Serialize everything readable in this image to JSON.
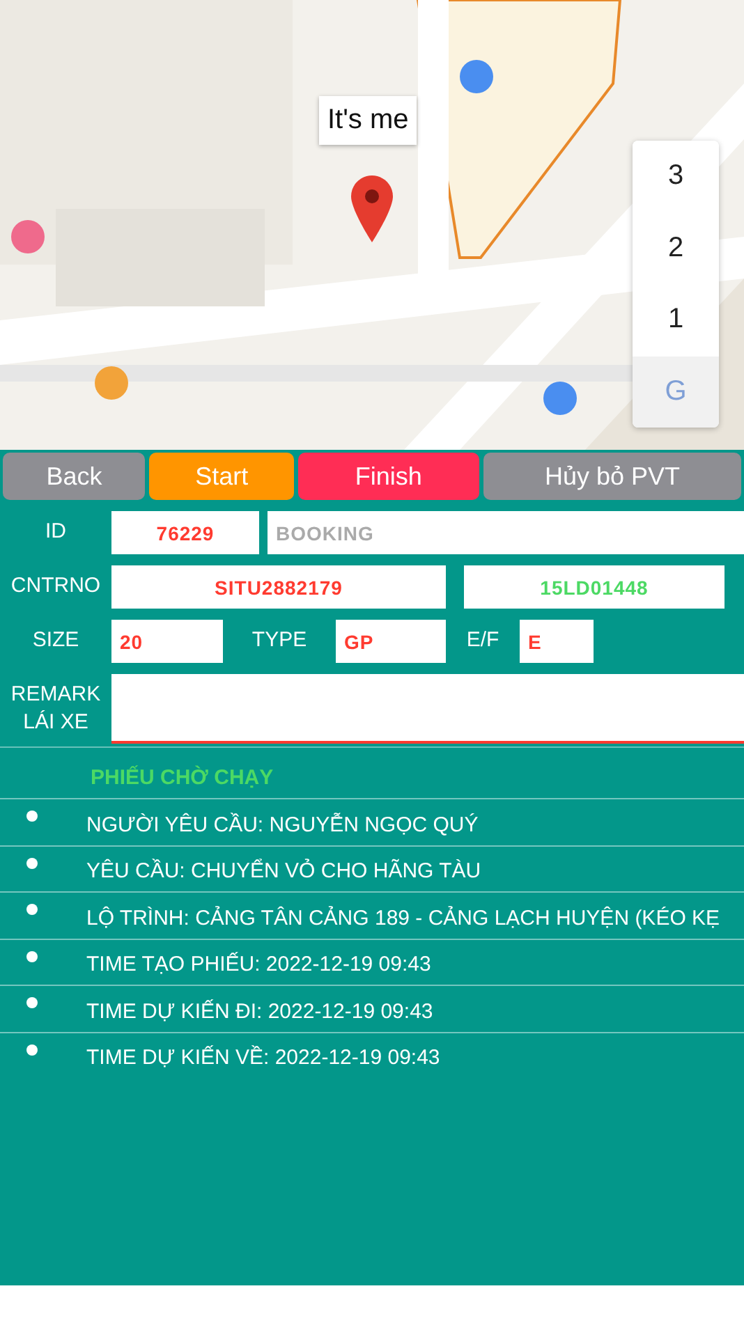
{
  "map": {
    "callout": "It's me",
    "floors": [
      {
        "label": "3",
        "selected": false
      },
      {
        "label": "2",
        "selected": false
      },
      {
        "label": "1",
        "selected": false
      },
      {
        "label": "G",
        "selected": true
      }
    ]
  },
  "buttons": [
    {
      "label": "Back",
      "kind": "neutral"
    },
    {
      "label": "Start",
      "kind": "start"
    },
    {
      "label": "Finish",
      "kind": "finish"
    },
    {
      "label": "Hủy bỏ PVT",
      "kind": "neutral"
    }
  ],
  "form": {
    "id_label": "ID",
    "id_value": "76229",
    "booking_placeholder": "BOOKING",
    "cntrno_label": "CNTRNO",
    "cntrno_value": "SITU2882179",
    "plate_value": "15LD01448",
    "size_label": "SIZE",
    "size_value": "20",
    "type_label": "TYPE",
    "type_value": "GP",
    "ef_label": "E/F",
    "ef_value": "E",
    "remark_label": "REMARK\nLÁI XE"
  },
  "details": {
    "title": "PHIẾU CHỜ CHẠY",
    "items": [
      "NGƯỜI YÊU CẦU: NGUYỄN NGỌC QUÝ",
      "YÊU CẦU: CHUYỂN VỎ CHO HÃNG TÀU",
      "LỘ TRÌNH: CẢNG TÂN CẢNG 189 - CẢNG LẠCH HUYỆN (KÉO KẸ",
      "TIME TẠO PHIẾU: 2022-12-19 09:43",
      "TIME DỰ KIẾN ĐI: 2022-12-19 09:43",
      "TIME DỰ KIẾN VỀ: 2022-12-19 09:43"
    ]
  }
}
